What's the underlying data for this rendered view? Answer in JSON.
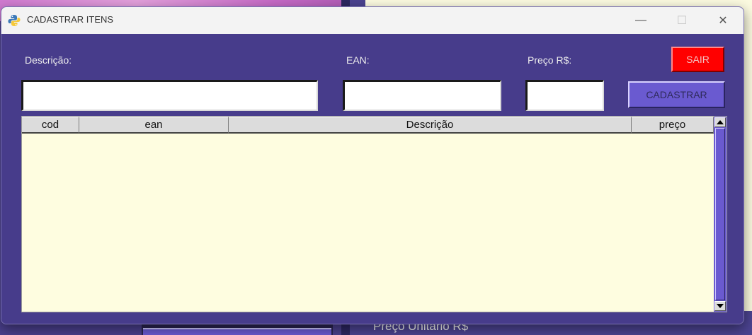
{
  "window": {
    "title": "CADASTRAR ITENS",
    "minimize_glyph": "—",
    "maximize_glyph": "☐",
    "close_glyph": "✕",
    "icon": "python-icon"
  },
  "form": {
    "descricao_label": "Descrição:",
    "ean_label": "EAN:",
    "preco_label": "Preço R$:",
    "descricao_value": "",
    "ean_value": "",
    "preco_value": ""
  },
  "buttons": {
    "sair_label": "SAIR",
    "cadastrar_label": "CADASTRAR"
  },
  "table": {
    "columns": [
      "cod",
      "ean",
      "Descrição",
      "preço"
    ],
    "rows": []
  },
  "background": {
    "partial_label": "Preço Unitário R$"
  },
  "colors": {
    "window_bg": "#473c8b",
    "table_bg": "#fefde0",
    "sair_bg": "#ff0000",
    "cadastrar_bg": "#6a5ad0"
  }
}
